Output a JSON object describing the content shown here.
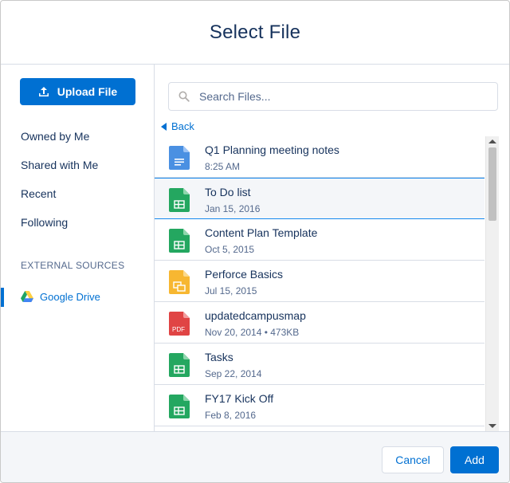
{
  "dialog": {
    "title": "Select File"
  },
  "sidebar": {
    "upload_label": "Upload File",
    "nav": [
      "Owned by Me",
      "Shared with Me",
      "Recent",
      "Following"
    ],
    "section_label": "EXTERNAL SOURCES",
    "sources": [
      {
        "label": "Google Drive",
        "icon": "google-drive-icon"
      }
    ]
  },
  "search": {
    "placeholder": "Search Files..."
  },
  "back_label": "Back",
  "files": [
    {
      "name": "Q1 Planning meeting notes",
      "meta": "8:25 AM",
      "icon": "doc-icon",
      "color": "#4a90e2"
    },
    {
      "name": "To Do list",
      "meta": "Jan 15, 2016",
      "icon": "sheet-icon",
      "color": "#24a760"
    },
    {
      "name": "Content Plan Template",
      "meta": "Oct 5, 2015",
      "icon": "sheet-icon",
      "color": "#24a760"
    },
    {
      "name": "Perforce Basics",
      "meta": "Jul 15, 2015",
      "icon": "slides-icon",
      "color": "#f7b731"
    },
    {
      "name": "updatedcampusmap",
      "meta": "Nov 20, 2014 • 473KB",
      "icon": "pdf-icon",
      "color": "#e04444"
    },
    {
      "name": "Tasks",
      "meta": "Sep 22, 2014",
      "icon": "sheet-icon",
      "color": "#24a760"
    },
    {
      "name": "FY17 Kick Off",
      "meta": "Feb 8, 2016",
      "icon": "sheet-icon",
      "color": "#24a760"
    }
  ],
  "selected_file": "To Do list",
  "footer": {
    "cancel_label": "Cancel",
    "add_label": "Add"
  },
  "colors": {
    "brand": "#0070d2",
    "text": "#16325c",
    "muted": "#54698d"
  }
}
